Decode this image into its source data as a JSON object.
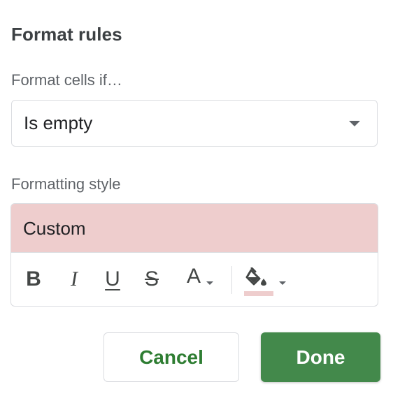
{
  "panel": {
    "title": "Format rules",
    "condition_label": "Format cells if…",
    "condition_value": "Is empty",
    "style_label": "Formatting style",
    "preview_text": "Custom"
  },
  "toolbar": {
    "bold": "B",
    "italic": "I",
    "underline": "U",
    "strikethrough": "S",
    "text_color": "A",
    "fill_color": "#eecdcd"
  },
  "buttons": {
    "cancel": "Cancel",
    "done": "Done"
  },
  "colors": {
    "preview_background": "#eecdcd",
    "accent_green": "#43894b",
    "cancel_text": "#2e7d32"
  },
  "icons": {
    "dropdown": "chevron-down-icon",
    "fill": "paint-bucket-icon"
  }
}
